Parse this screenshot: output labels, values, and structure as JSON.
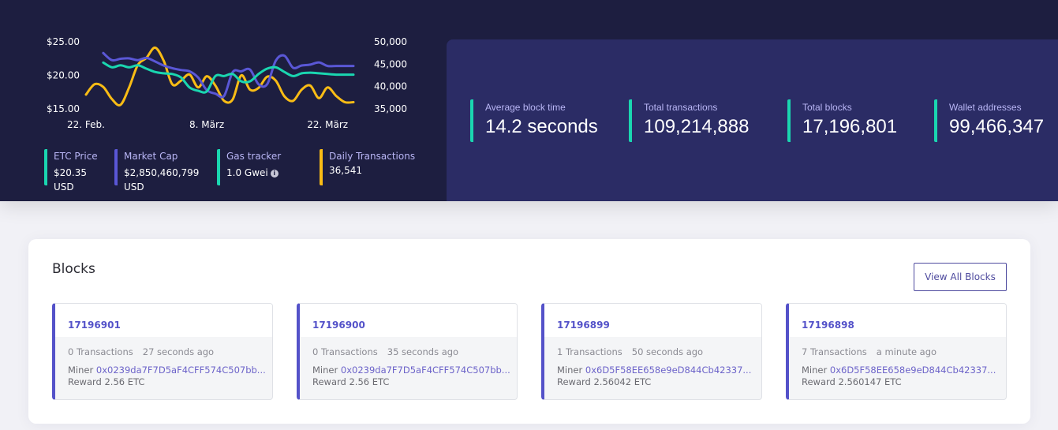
{
  "chart_data": {
    "type": "line",
    "title": "",
    "x_ticks": [
      "22. Feb.",
      "8. März",
      "22. März"
    ],
    "y_left_ticks": [
      "$25.00",
      "$20.00",
      "$15.00"
    ],
    "y_left_range": [
      15,
      25
    ],
    "y_right_ticks": [
      "50,000",
      "45,000",
      "40,000",
      "35,000"
    ],
    "y_right_range": [
      35000,
      50000
    ],
    "x_range_days": [
      0,
      31
    ],
    "series": [
      {
        "name": "Daily Transactions",
        "axis": "right",
        "color": "#f9bc15",
        "x": [
          0,
          1,
          2,
          3,
          4,
          5,
          6,
          7,
          8,
          9,
          10,
          11,
          12,
          13,
          14,
          15,
          16,
          17,
          18,
          19,
          20,
          21,
          22,
          23,
          24,
          25,
          26,
          27,
          28,
          29,
          30,
          31
        ],
        "values": [
          38200,
          40500,
          39900,
          37200,
          35900,
          39800,
          44800,
          46400,
          48700,
          45800,
          40500,
          41300,
          42700,
          39800,
          42300,
          40200,
          36800,
          37100,
          42500,
          39300,
          39700,
          42200,
          41300,
          37800,
          36800,
          39300,
          40200,
          37400,
          39800,
          37900,
          36500,
          36500
        ]
      },
      {
        "name": "Market Cap",
        "axis": "right",
        "color": "#5a57d6",
        "x": [
          2,
          3,
          4,
          5,
          6,
          7,
          8,
          9,
          10,
          11,
          12,
          13,
          14,
          15,
          16,
          17,
          18,
          19,
          20,
          21,
          22,
          23,
          24,
          25,
          26,
          27,
          28,
          29,
          30,
          31
        ],
        "values": [
          47500,
          45900,
          46200,
          46300,
          45900,
          46400,
          45600,
          44700,
          44100,
          43700,
          43400,
          42000,
          39200,
          38400,
          37900,
          43200,
          43400,
          43800,
          40500,
          40500,
          45800,
          46900,
          44200,
          44700,
          44900,
          45400,
          44600,
          44600,
          44600,
          44600
        ]
      },
      {
        "name": "ETC Price",
        "axis": "left",
        "color": "#1ad6b0",
        "x": [
          2,
          3,
          4,
          5,
          6,
          7,
          8,
          9,
          10,
          11,
          12,
          13,
          14,
          15,
          16,
          17,
          18,
          19,
          20,
          21,
          22,
          23,
          24,
          25,
          26,
          27,
          28,
          29,
          30,
          31
        ],
        "values": [
          21.9,
          21.2,
          21.5,
          21.2,
          21.5,
          21.0,
          20.5,
          20.3,
          20.2,
          19.7,
          18.2,
          17.7,
          17.6,
          19.9,
          19.9,
          20.2,
          19.1,
          19.1,
          20.2,
          21.0,
          21.2,
          20.5,
          19.9,
          20.3,
          20.4,
          20.3,
          20.2,
          20.1,
          20.1,
          20.1
        ]
      }
    ]
  },
  "hero": {
    "mini_stats": [
      {
        "label": "ETC Price",
        "value": "$20.35 USD",
        "color": "#1ad6b0"
      },
      {
        "label": "Market Cap",
        "value": "$2,850,460,799 USD",
        "color": "#5a57d6"
      },
      {
        "label": "Gas tracker",
        "value": "1.0 Gwei",
        "icon": "info-icon",
        "color": "#1ad6b0"
      },
      {
        "label": "Daily Transactions",
        "value": "36,541",
        "color": "#f9bc15"
      }
    ],
    "big_stats": [
      {
        "label": "Average block time",
        "value": "14.2 seconds"
      },
      {
        "label": "Total transactions",
        "value": "109,214,888"
      },
      {
        "label": "Total blocks",
        "value": "17,196,801"
      },
      {
        "label": "Wallet addresses",
        "value": "99,466,347"
      }
    ]
  },
  "blocks_section": {
    "title": "Blocks",
    "view_all_label": "View All Blocks",
    "miner_label": "Miner",
    "reward_label": "Reward",
    "blocks": [
      {
        "number": "17196901",
        "transactions": "0 Transactions",
        "age": "27 seconds ago",
        "miner": "0x0239da7F7D5aF4CFF574C507bb...",
        "reward": "2.56 ETC"
      },
      {
        "number": "17196900",
        "transactions": "0 Transactions",
        "age": "35 seconds ago",
        "miner": "0x0239da7F7D5aF4CFF574C507bb...",
        "reward": "2.56 ETC"
      },
      {
        "number": "17196899",
        "transactions": "1 Transactions",
        "age": "50 seconds ago",
        "miner": "0x6D5F58EE658e9eD844Cb42337...",
        "reward": "2.56042 ETC"
      },
      {
        "number": "17196898",
        "transactions": "7 Transactions",
        "age": "a minute ago",
        "miner": "0x6D5F58EE658e9eD844Cb42337...",
        "reward": "2.560147 ETC"
      }
    ]
  },
  "colors": {
    "hero_bg": "#1d1e40",
    "panel_bg": "#2b2c65",
    "accent_teal": "#1ad6b0",
    "accent_purple": "#5a57d6",
    "accent_yellow": "#f9bc15"
  }
}
